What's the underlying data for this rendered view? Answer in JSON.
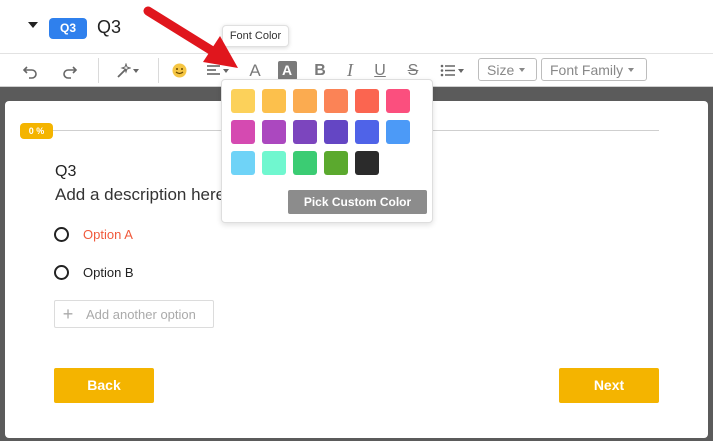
{
  "question": {
    "badge": "Q3",
    "title": "Q3",
    "heading": "Q3",
    "description": "Add a description here"
  },
  "toolbar": {
    "tooltip": "Font Color",
    "size_label": "Size",
    "font_family_label": "Font Family",
    "icons": [
      "undo-icon",
      "redo-icon",
      "magic-wand-icon",
      "emoji-icon",
      "align-icon",
      "font-color-icon",
      "highlight-icon",
      "bold-icon",
      "italic-icon",
      "underline-icon",
      "strikethrough-icon",
      "list-icon"
    ]
  },
  "progress": {
    "label": "0 %",
    "value": 0
  },
  "options": [
    {
      "label": "Option A",
      "color": "#f05a3c"
    },
    {
      "label": "Option B",
      "color": "#222222"
    }
  ],
  "add_option_label": "Add another option",
  "buttons": {
    "back": "Back",
    "next": "Next"
  },
  "color_picker": {
    "pick_custom_label": "Pick Custom Color",
    "swatches": [
      [
        "#fcd15a",
        "#fcc04c",
        "#fbab50",
        "#fb8356",
        "#fb6550",
        "#fb4f7e"
      ],
      [
        "#d54ab1",
        "#ab48bf",
        "#7c45be",
        "#6446c4",
        "#4f63e8",
        "#4c9af7"
      ],
      [
        "#6fd3f7",
        "#70f7cf",
        "#3bcc73",
        "#5ba92e",
        "#2b2b2b"
      ]
    ]
  },
  "colors": {
    "accent": "#f4b400",
    "badge": "#2f80ed",
    "arrow": "#e0161d"
  }
}
